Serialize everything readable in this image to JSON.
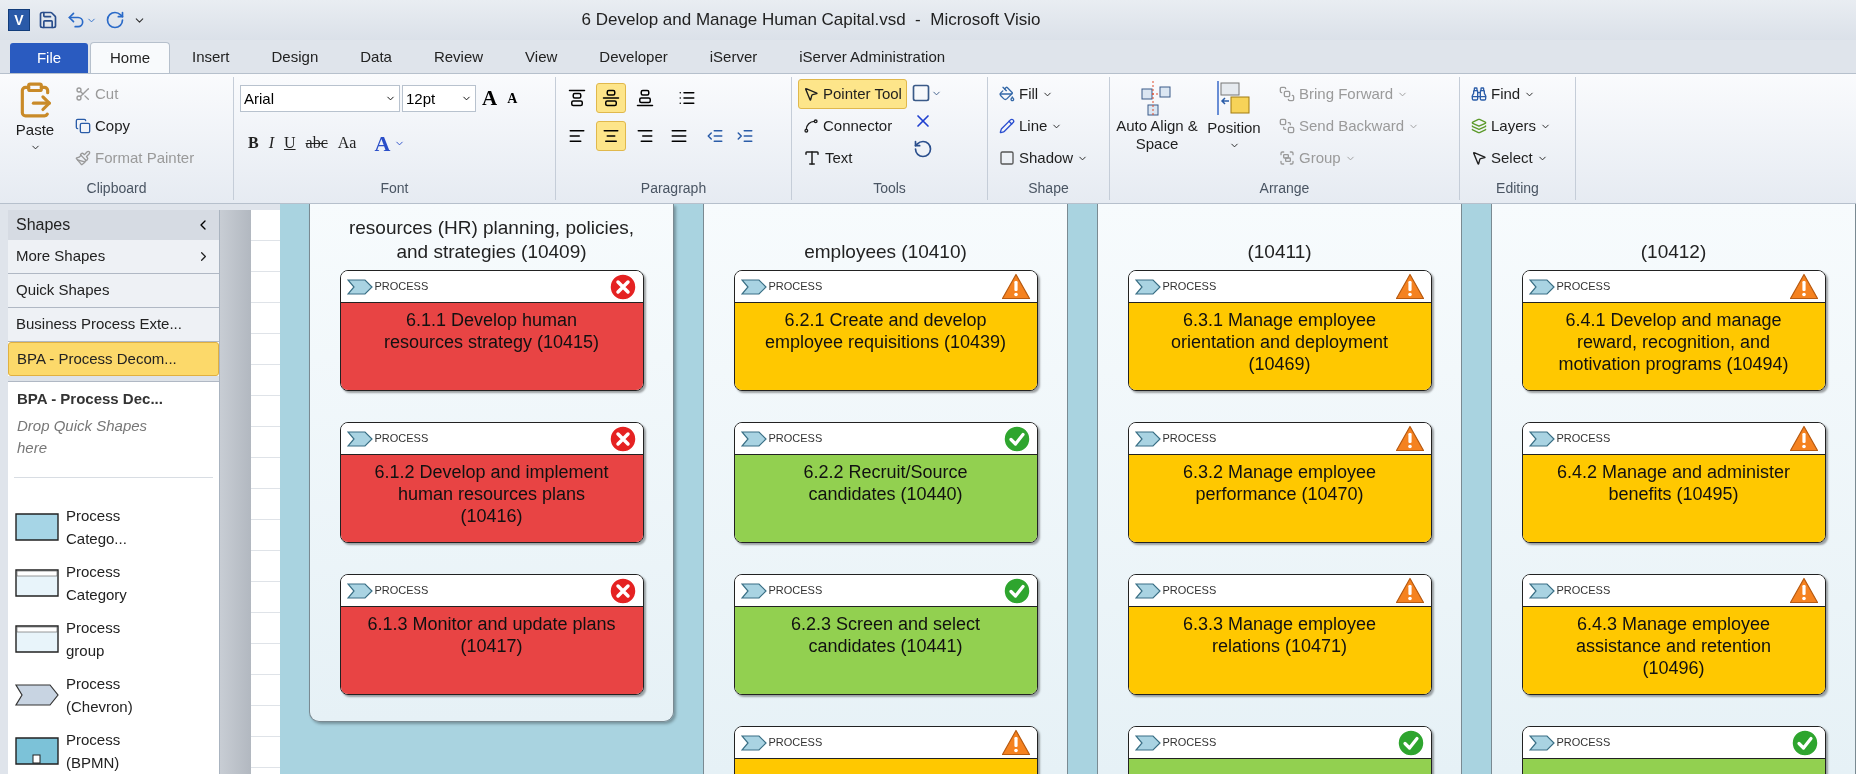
{
  "window": {
    "app_logo": "V",
    "title": "6 Develop and Manage Human Capital.vsd  -  Microsoft Visio"
  },
  "tabs": [
    {
      "label": "File",
      "kind": "file",
      "selected": false
    },
    {
      "label": "Home",
      "kind": "tab",
      "selected": true
    },
    {
      "label": "Insert",
      "kind": "tab",
      "selected": false
    },
    {
      "label": "Design",
      "kind": "tab",
      "selected": false
    },
    {
      "label": "Data",
      "kind": "tab",
      "selected": false
    },
    {
      "label": "Review",
      "kind": "tab",
      "selected": false
    },
    {
      "label": "View",
      "kind": "tab",
      "selected": false
    },
    {
      "label": "Developer",
      "kind": "tab",
      "selected": false
    },
    {
      "label": "iServer",
      "kind": "tab",
      "selected": false
    },
    {
      "label": "iServer Administration",
      "kind": "tab",
      "selected": false
    }
  ],
  "ribbon": {
    "clipboard": {
      "label": "Clipboard",
      "paste": "Paste",
      "items": [
        {
          "label": "Cut",
          "disabled": true
        },
        {
          "label": "Copy",
          "disabled": false
        },
        {
          "label": "Format Painter",
          "disabled": true
        }
      ]
    },
    "font": {
      "label": "Font",
      "font_name": "Arial",
      "font_size": "12pt",
      "format_buttons": [
        {
          "label": "B",
          "kind": "bold"
        },
        {
          "label": "I",
          "kind": "italic"
        },
        {
          "label": "U",
          "kind": "underline"
        },
        {
          "label": "abc",
          "kind": "strike"
        },
        {
          "label": "Aa",
          "kind": "case"
        }
      ],
      "color_button": "A",
      "grow": "A",
      "shrink": "A"
    },
    "paragraph": {
      "label": "Paragraph",
      "vertical_align": [
        {
          "selected": false
        },
        {
          "selected": true
        },
        {
          "selected": false
        }
      ],
      "horizontal_align": [
        {
          "selected": false
        },
        {
          "selected": true
        },
        {
          "selected": false
        },
        {
          "selected": false
        }
      ]
    },
    "tools": {
      "label": "Tools",
      "items": [
        {
          "label": "Pointer Tool",
          "kind": "pointer",
          "selected": true
        },
        {
          "label": "Connector",
          "kind": "connector",
          "selected": false
        },
        {
          "label": "Text",
          "kind": "text",
          "selected": false
        }
      ]
    },
    "shape": {
      "label": "Shape",
      "items": [
        {
          "label": "Fill",
          "kind": "fill"
        },
        {
          "label": "Line",
          "kind": "line"
        },
        {
          "label": "Shadow",
          "kind": "shadow"
        }
      ]
    },
    "arrange": {
      "label": "Arrange",
      "auto_align": "Auto Align & Space",
      "position": "Position",
      "items": [
        {
          "label": "Bring Forward",
          "disabled": true
        },
        {
          "label": "Send Backward",
          "disabled": true
        },
        {
          "label": "Group",
          "disabled": true
        }
      ]
    },
    "editing": {
      "label": "Editing",
      "items": [
        {
          "label": "Find",
          "kind": "find"
        },
        {
          "label": "Layers",
          "kind": "layers"
        },
        {
          "label": "Select",
          "kind": "select"
        }
      ]
    }
  },
  "shapes_pane": {
    "title": "Shapes",
    "menu": [
      {
        "label": "More Shapes",
        "kind": "submenu",
        "selected": false
      },
      {
        "label": "Quick Shapes",
        "kind": "item",
        "selected": false
      },
      {
        "label": "Business Process Exte...",
        "kind": "item",
        "selected": false
      },
      {
        "label": "BPA - Process Decom...",
        "kind": "item",
        "selected": true
      }
    ],
    "stencil_title": "BPA - Process Dec...",
    "drop_hint": "Drop Quick Shapes here",
    "shapes": [
      {
        "label": "Process Catego...",
        "kind": "category_blue"
      },
      {
        "label": "Process Category",
        "kind": "category"
      },
      {
        "label": "Process group",
        "kind": "group"
      },
      {
        "label": "Process (Chevron)",
        "kind": "chevron"
      },
      {
        "label": "Process (BPMN)",
        "kind": "bpmn"
      }
    ]
  },
  "diagram": {
    "columns": [
      {
        "title_lines": [
          "resources (HR) planning, policies,",
          "and strategies (10409)"
        ],
        "ends": true,
        "cards": [
          {
            "type": "PROCESS",
            "kind": "error",
            "title": "6.1.1 Develop human resources strategy (10415)"
          },
          {
            "type": "PROCESS",
            "kind": "error",
            "title": "6.1.2 Develop and implement human resources plans (10416)"
          },
          {
            "type": "PROCESS",
            "kind": "error",
            "title": "6.1.3 Monitor and update plans (10417)"
          }
        ]
      },
      {
        "title_lines": [
          "employees (10410)"
        ],
        "ends": false,
        "cards": [
          {
            "type": "PROCESS",
            "kind": "warning",
            "title": "6.2.1 Create and develop employee requisitions (10439)"
          },
          {
            "type": "PROCESS",
            "kind": "ok",
            "title": "6.2.2 Recruit/Source candidates (10440)"
          },
          {
            "type": "PROCESS",
            "kind": "ok",
            "title": "6.2.3 Screen and select candidates (10441)"
          },
          {
            "type": "PROCESS",
            "kind": "warning"
          }
        ]
      },
      {
        "title_lines": [
          "(10411)"
        ],
        "ends": false,
        "cards": [
          {
            "type": "PROCESS",
            "kind": "warning",
            "title": "6.3.1 Manage employee orientation and deployment (10469)"
          },
          {
            "type": "PROCESS",
            "kind": "warning",
            "title": "6.3.2 Manage employee performance (10470)"
          },
          {
            "type": "PROCESS",
            "kind": "warning",
            "title": "6.3.3 Manage employee relations (10471)"
          },
          {
            "type": "PROCESS",
            "kind": "ok"
          }
        ]
      },
      {
        "title_lines": [
          "(10412)"
        ],
        "ends": false,
        "cards": [
          {
            "type": "PROCESS",
            "kind": "warning",
            "title": "6.4.1 Develop and manage reward, recognition, and motivation programs (10494)"
          },
          {
            "type": "PROCESS",
            "kind": "warning",
            "title": "6.4.2 Manage and administer benefits (10495)"
          },
          {
            "type": "PROCESS",
            "kind": "warning",
            "title": "6.4.3 Manage employee assistance and retention (10496)"
          },
          {
            "type": "PROCESS",
            "kind": "ok"
          }
        ]
      }
    ]
  }
}
